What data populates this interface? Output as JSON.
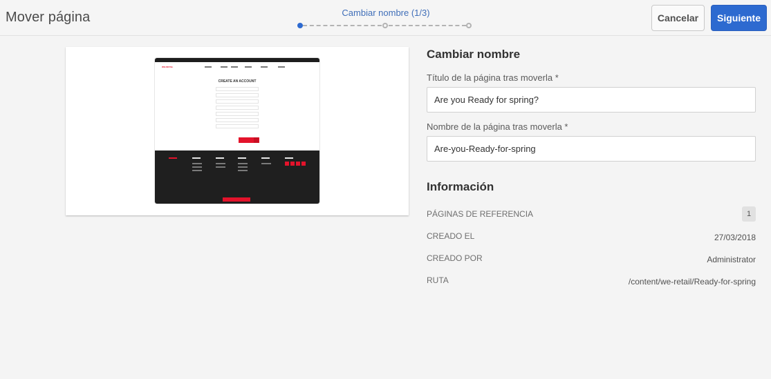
{
  "header": {
    "title": "Mover página",
    "cancel_label": "Cancelar",
    "next_label": "Siguiente"
  },
  "wizard": {
    "step_label": "Cambiar nombre (1/3)",
    "current_step": 1,
    "total_steps": 3
  },
  "preview": {
    "thumb_logo": "WE.RETAIL",
    "thumb_form_title": "CREATE AN ACCOUNT"
  },
  "rename": {
    "section_title": "Cambiar nombre",
    "title_label": "Título de la página tras moverla *",
    "title_value": "Are you Ready for spring?",
    "name_label": "Nombre de la página tras moverla *",
    "name_value": "Are-you-Ready-for-spring"
  },
  "info": {
    "section_title": "Información",
    "rows": [
      {
        "key": "PÁGINAS DE REFERENCIA",
        "value": "1"
      },
      {
        "key": "CREADO EL",
        "value": "27/03/2018"
      },
      {
        "key": "CREADO POR",
        "value": "Administrator"
      },
      {
        "key": "RUTA",
        "value": "/content/we-retail/Ready-for-spring"
      }
    ]
  },
  "colors": {
    "accent": "#2d6ad0",
    "brand_red": "#e3132b"
  }
}
